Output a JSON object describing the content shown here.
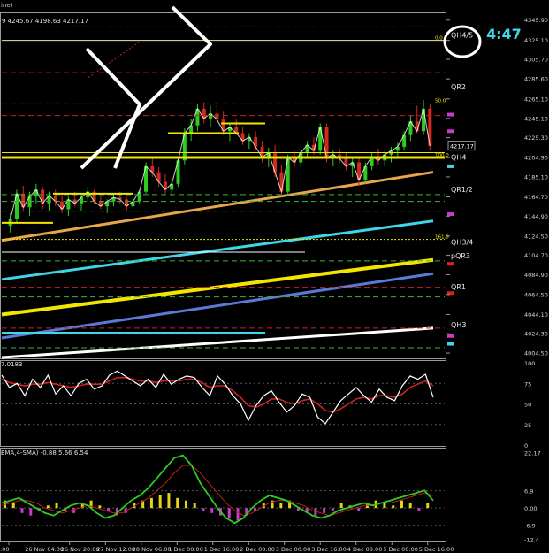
{
  "window": {
    "title_fragment": "ine)",
    "ohlc_text": "9 4245.67 4198.63 4217.17"
  },
  "timer": {
    "text": "4:47"
  },
  "colors": {
    "background": "#000000",
    "candle_up": "#2ecc1f",
    "candle_down": "#d22a1e",
    "fib_yellow": "#f2e600",
    "level_white": "#ffffff",
    "ma_cyan": "#3fd6e8",
    "ma_blue": "#5a7ad8",
    "ma_orange": "#e8a64c",
    "ma_red_dash": "#c8202a",
    "level_green_dash": "#3cb43c",
    "hist_yellow": "#e6d21e",
    "hist_magenta": "#c83cc8"
  },
  "price_axis": {
    "labels": [
      "4345.90",
      "4325.10",
      "4305.70",
      "4285.60",
      "4265.10",
      "4245.10",
      "4225.30",
      "4204.90",
      "4185.10",
      "4164.70",
      "4144.90",
      "4124.50",
      "4104.70",
      "4084.90",
      "4064.50",
      "4044.10",
      "4024.30",
      "4004.50"
    ],
    "current_price": "4217.17",
    "range": [
      4000,
      4352
    ]
  },
  "level_labels": [
    {
      "text": "QH4/5",
      "price": 4325.1
    },
    {
      "text": "QR2",
      "price": 4272
    },
    {
      "text": "QH4",
      "price": 4200
    },
    {
      "text": "QR1/2",
      "price": 4167
    },
    {
      "text": "QH3/4",
      "price": 4113
    },
    {
      "text": "pQR3",
      "price": 4099
    },
    {
      "text": "QR1",
      "price": 4067
    },
    {
      "text": "QH3",
      "price": 4028
    }
  ],
  "fib_labels": [
    {
      "text": "0.0",
      "price": 4325.1
    },
    {
      "text": "50.0",
      "price": 4261
    },
    {
      "text": "100.0",
      "price": 4205
    },
    {
      "text": "161.8",
      "price": 4121
    }
  ],
  "stoch_panel": {
    "label_fragment": "7.0183",
    "axis_labels": [
      "100",
      "75",
      "50",
      "25",
      "0"
    ],
    "range": [
      0,
      100
    ]
  },
  "macd_panel": {
    "label_fragment": "EMA,4-SMA) -0.88 5.66 6.54",
    "axis_labels": [
      "22.17",
      "6.9",
      "0.00",
      "-6.9",
      "-12.4"
    ],
    "range": [
      -13,
      23
    ]
  },
  "time_axis": {
    "labels": [
      ":00",
      "26 Nov 04:00",
      "26 Nov 20:00",
      "27 Nov 12:00",
      "28 Nov 06:00",
      "1 Dec 00:00",
      "1 Dec 16:00",
      "2 Dec 08:00",
      "3 Dec 00:00",
      "3 Dec 16:00",
      "4 Dec 08:00",
      "5 Dec 00:00",
      "5 Dec 16:00"
    ]
  },
  "chart_data": {
    "type": "candlestick",
    "title": "",
    "ylim": [
      4000,
      4352
    ],
    "candles": [
      [
        4135,
        4148,
        4128,
        4142
      ],
      [
        4142,
        4172,
        4138,
        4168
      ],
      [
        4168,
        4176,
        4150,
        4154
      ],
      [
        4154,
        4170,
        4145,
        4165
      ],
      [
        4165,
        4178,
        4158,
        4172
      ],
      [
        4172,
        4175,
        4152,
        4158
      ],
      [
        4158,
        4170,
        4150,
        4166
      ],
      [
        4166,
        4172,
        4155,
        4160
      ],
      [
        4160,
        4168,
        4148,
        4152
      ],
      [
        4152,
        4165,
        4145,
        4162
      ],
      [
        4162,
        4170,
        4155,
        4158
      ],
      [
        4158,
        4168,
        4150,
        4164
      ],
      [
        4164,
        4175,
        4160,
        4170
      ],
      [
        4170,
        4172,
        4158,
        4160
      ],
      [
        4160,
        4166,
        4152,
        4155
      ],
      [
        4155,
        4162,
        4148,
        4160
      ],
      [
        4160,
        4168,
        4155,
        4164
      ],
      [
        4164,
        4170,
        4158,
        4162
      ],
      [
        4162,
        4166,
        4150,
        4155
      ],
      [
        4155,
        4163,
        4148,
        4160
      ],
      [
        4160,
        4172,
        4158,
        4170
      ],
      [
        4170,
        4200,
        4168,
        4196
      ],
      [
        4196,
        4205,
        4185,
        4190
      ],
      [
        4190,
        4195,
        4175,
        4180
      ],
      [
        4180,
        4188,
        4168,
        4172
      ],
      [
        4172,
        4182,
        4165,
        4178
      ],
      [
        4178,
        4206,
        4175,
        4202
      ],
      [
        4202,
        4235,
        4198,
        4230
      ],
      [
        4230,
        4245,
        4222,
        4238
      ],
      [
        4238,
        4260,
        4232,
        4255
      ],
      [
        4255,
        4262,
        4240,
        4245
      ],
      [
        4245,
        4258,
        4236,
        4250
      ],
      [
        4250,
        4262,
        4240,
        4244
      ],
      [
        4244,
        4252,
        4228,
        4232
      ],
      [
        4232,
        4240,
        4222,
        4236
      ],
      [
        4236,
        4244,
        4228,
        4230
      ],
      [
        4230,
        4236,
        4218,
        4222
      ],
      [
        4222,
        4230,
        4214,
        4226
      ],
      [
        4226,
        4232,
        4212,
        4216
      ],
      [
        4216,
        4222,
        4200,
        4205
      ],
      [
        4205,
        4215,
        4195,
        4210
      ],
      [
        4210,
        4218,
        4185,
        4190
      ],
      [
        4190,
        4198,
        4165,
        4170
      ],
      [
        4170,
        4208,
        4168,
        4205
      ],
      [
        4205,
        4212,
        4195,
        4200
      ],
      [
        4200,
        4214,
        4196,
        4210
      ],
      [
        4210,
        4222,
        4204,
        4218
      ],
      [
        4218,
        4226,
        4208,
        4212
      ],
      [
        4212,
        4240,
        4208,
        4236
      ],
      [
        4236,
        4240,
        4200,
        4205
      ],
      [
        4205,
        4212,
        4196,
        4208
      ],
      [
        4208,
        4214,
        4200,
        4204
      ],
      [
        4204,
        4210,
        4192,
        4196
      ],
      [
        4196,
        4204,
        4185,
        4200
      ],
      [
        4200,
        4206,
        4176,
        4182
      ],
      [
        4182,
        4200,
        4178,
        4196
      ],
      [
        4196,
        4210,
        4192,
        4206
      ],
      [
        4206,
        4214,
        4198,
        4202
      ],
      [
        4202,
        4212,
        4196,
        4208
      ],
      [
        4208,
        4216,
        4200,
        4212
      ],
      [
        4212,
        4220,
        4205,
        4216
      ],
      [
        4216,
        4232,
        4212,
        4228
      ],
      [
        4228,
        4248,
        4222,
        4242
      ],
      [
        4242,
        4258,
        4230,
        4232
      ],
      [
        4232,
        4264,
        4228,
        4255
      ],
      [
        4255,
        4260,
        4212,
        4217
      ]
    ],
    "moving_averages": [
      {
        "color": "#3fd6e8",
        "values": [
          4080,
          4140
        ]
      },
      {
        "color": "#f2e600",
        "values": [
          4044,
          4100
        ]
      },
      {
        "color": "#5a7ad8",
        "values": [
          4020,
          4086
        ]
      },
      {
        "color": "#e8a64c",
        "values": [
          4120,
          4190
        ]
      },
      {
        "color": "#ffffff",
        "values": [
          4000,
          4030
        ]
      }
    ],
    "stochastic": {
      "main": [
        85,
        70,
        75,
        60,
        80,
        70,
        85,
        62,
        72,
        60,
        75,
        80,
        68,
        72,
        85,
        90,
        84,
        78,
        72,
        80,
        70,
        86,
        74,
        80,
        84,
        82,
        70,
        60,
        84,
        74,
        60,
        50,
        30,
        48,
        60,
        66,
        52,
        40,
        48,
        62,
        58,
        34,
        26,
        40,
        54,
        62,
        70,
        60,
        52,
        68,
        58,
        54,
        72,
        84,
        80,
        86,
        58
      ],
      "signal": [
        80,
        76,
        74,
        72,
        74,
        74,
        76,
        74,
        72,
        70,
        72,
        74,
        74,
        74,
        78,
        82,
        82,
        80,
        78,
        78,
        76,
        78,
        78,
        78,
        80,
        80,
        76,
        70,
        72,
        72,
        66,
        58,
        48,
        46,
        50,
        56,
        56,
        52,
        50,
        54,
        56,
        50,
        42,
        40,
        44,
        50,
        56,
        58,
        56,
        60,
        60,
        58,
        62,
        70,
        74,
        78,
        72
      ]
    },
    "macd": {
      "main": [
        2,
        3,
        4,
        2,
        0,
        -2,
        -3,
        -1,
        1,
        2,
        1,
        -2,
        -4,
        -3,
        0,
        3,
        5,
        8,
        12,
        16,
        20,
        21,
        17,
        10,
        5,
        0,
        -4,
        -6,
        -4,
        0,
        3,
        5,
        4,
        3,
        1,
        -1,
        -3,
        -4,
        -3,
        -1,
        0,
        1,
        2,
        1,
        2,
        3,
        4,
        5,
        6,
        7,
        3
      ],
      "signal": [
        1,
        2,
        3,
        3,
        2,
        0,
        -1,
        -2,
        -1,
        0,
        1,
        0,
        -1,
        -2,
        -2,
        0,
        2,
        4,
        7,
        10,
        14,
        17,
        17,
        14,
        10,
        6,
        2,
        -1,
        -3,
        -2,
        0,
        2,
        3,
        3,
        2,
        1,
        -1,
        -2,
        -3,
        -2,
        -1,
        0,
        1,
        1,
        2,
        2,
        3,
        4,
        5,
        6,
        5
      ],
      "hist": [
        3,
        2,
        -2,
        -3,
        -1,
        1,
        2,
        -1,
        -2,
        2,
        3,
        1,
        -1,
        -3,
        -2,
        2,
        3,
        4,
        5,
        6,
        4,
        3,
        2,
        -1,
        -2,
        -3,
        -4,
        -5,
        -3,
        -1,
        2,
        3,
        2,
        3,
        -1,
        -2,
        -3,
        -2,
        -1,
        2,
        1,
        -1,
        2,
        3,
        2,
        1,
        3,
        2,
        -1,
        2
      ]
    },
    "annotations": [
      "hand-drawn white arrow pointing right",
      "white circle around 4:47 timer"
    ]
  }
}
